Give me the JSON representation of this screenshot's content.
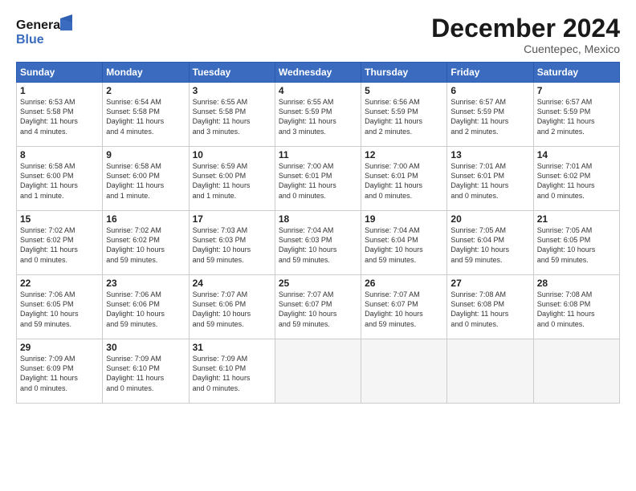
{
  "header": {
    "logo_general": "General",
    "logo_blue": "Blue",
    "month_title": "December 2024",
    "location": "Cuentepec, Mexico"
  },
  "weekdays": [
    "Sunday",
    "Monday",
    "Tuesday",
    "Wednesday",
    "Thursday",
    "Friday",
    "Saturday"
  ],
  "days": [
    {
      "num": "",
      "info": ""
    },
    {
      "num": "",
      "info": ""
    },
    {
      "num": "",
      "info": ""
    },
    {
      "num": "",
      "info": ""
    },
    {
      "num": "",
      "info": ""
    },
    {
      "num": "",
      "info": ""
    },
    {
      "num": "1",
      "info": "Sunrise: 6:53 AM\nSunset: 5:58 PM\nDaylight: 11 hours\nand 4 minutes."
    },
    {
      "num": "2",
      "info": "Sunrise: 6:54 AM\nSunset: 5:58 PM\nDaylight: 11 hours\nand 4 minutes."
    },
    {
      "num": "3",
      "info": "Sunrise: 6:55 AM\nSunset: 5:58 PM\nDaylight: 11 hours\nand 3 minutes."
    },
    {
      "num": "4",
      "info": "Sunrise: 6:55 AM\nSunset: 5:59 PM\nDaylight: 11 hours\nand 3 minutes."
    },
    {
      "num": "5",
      "info": "Sunrise: 6:56 AM\nSunset: 5:59 PM\nDaylight: 11 hours\nand 2 minutes."
    },
    {
      "num": "6",
      "info": "Sunrise: 6:57 AM\nSunset: 5:59 PM\nDaylight: 11 hours\nand 2 minutes."
    },
    {
      "num": "7",
      "info": "Sunrise: 6:57 AM\nSunset: 5:59 PM\nDaylight: 11 hours\nand 2 minutes."
    },
    {
      "num": "8",
      "info": "Sunrise: 6:58 AM\nSunset: 6:00 PM\nDaylight: 11 hours\nand 1 minute."
    },
    {
      "num": "9",
      "info": "Sunrise: 6:58 AM\nSunset: 6:00 PM\nDaylight: 11 hours\nand 1 minute."
    },
    {
      "num": "10",
      "info": "Sunrise: 6:59 AM\nSunset: 6:00 PM\nDaylight: 11 hours\nand 1 minute."
    },
    {
      "num": "11",
      "info": "Sunrise: 7:00 AM\nSunset: 6:01 PM\nDaylight: 11 hours\nand 0 minutes."
    },
    {
      "num": "12",
      "info": "Sunrise: 7:00 AM\nSunset: 6:01 PM\nDaylight: 11 hours\nand 0 minutes."
    },
    {
      "num": "13",
      "info": "Sunrise: 7:01 AM\nSunset: 6:01 PM\nDaylight: 11 hours\nand 0 minutes."
    },
    {
      "num": "14",
      "info": "Sunrise: 7:01 AM\nSunset: 6:02 PM\nDaylight: 11 hours\nand 0 minutes."
    },
    {
      "num": "15",
      "info": "Sunrise: 7:02 AM\nSunset: 6:02 PM\nDaylight: 11 hours\nand 0 minutes."
    },
    {
      "num": "16",
      "info": "Sunrise: 7:02 AM\nSunset: 6:02 PM\nDaylight: 10 hours\nand 59 minutes."
    },
    {
      "num": "17",
      "info": "Sunrise: 7:03 AM\nSunset: 6:03 PM\nDaylight: 10 hours\nand 59 minutes."
    },
    {
      "num": "18",
      "info": "Sunrise: 7:04 AM\nSunset: 6:03 PM\nDaylight: 10 hours\nand 59 minutes."
    },
    {
      "num": "19",
      "info": "Sunrise: 7:04 AM\nSunset: 6:04 PM\nDaylight: 10 hours\nand 59 minutes."
    },
    {
      "num": "20",
      "info": "Sunrise: 7:05 AM\nSunset: 6:04 PM\nDaylight: 10 hours\nand 59 minutes."
    },
    {
      "num": "21",
      "info": "Sunrise: 7:05 AM\nSunset: 6:05 PM\nDaylight: 10 hours\nand 59 minutes."
    },
    {
      "num": "22",
      "info": "Sunrise: 7:06 AM\nSunset: 6:05 PM\nDaylight: 10 hours\nand 59 minutes."
    },
    {
      "num": "23",
      "info": "Sunrise: 7:06 AM\nSunset: 6:06 PM\nDaylight: 10 hours\nand 59 minutes."
    },
    {
      "num": "24",
      "info": "Sunrise: 7:07 AM\nSunset: 6:06 PM\nDaylight: 10 hours\nand 59 minutes."
    },
    {
      "num": "25",
      "info": "Sunrise: 7:07 AM\nSunset: 6:07 PM\nDaylight: 10 hours\nand 59 minutes."
    },
    {
      "num": "26",
      "info": "Sunrise: 7:07 AM\nSunset: 6:07 PM\nDaylight: 10 hours\nand 59 minutes."
    },
    {
      "num": "27",
      "info": "Sunrise: 7:08 AM\nSunset: 6:08 PM\nDaylight: 11 hours\nand 0 minutes."
    },
    {
      "num": "28",
      "info": "Sunrise: 7:08 AM\nSunset: 6:08 PM\nDaylight: 11 hours\nand 0 minutes."
    },
    {
      "num": "29",
      "info": "Sunrise: 7:09 AM\nSunset: 6:09 PM\nDaylight: 11 hours\nand 0 minutes."
    },
    {
      "num": "30",
      "info": "Sunrise: 7:09 AM\nSunset: 6:10 PM\nDaylight: 11 hours\nand 0 minutes."
    },
    {
      "num": "31",
      "info": "Sunrise: 7:09 AM\nSunset: 6:10 PM\nDaylight: 11 hours\nand 0 minutes."
    },
    {
      "num": "",
      "info": ""
    },
    {
      "num": "",
      "info": ""
    },
    {
      "num": "",
      "info": ""
    },
    {
      "num": "",
      "info": ""
    },
    {
      "num": "",
      "info": ""
    }
  ]
}
